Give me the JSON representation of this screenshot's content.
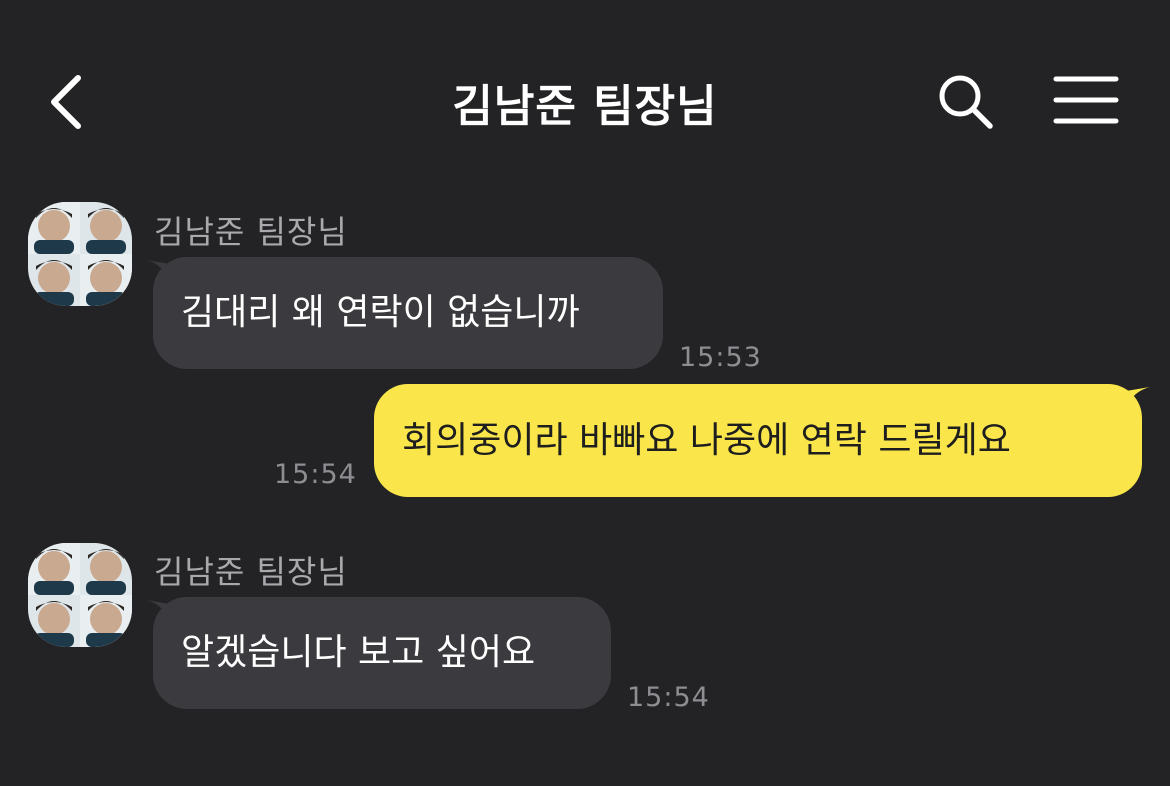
{
  "header": {
    "title": "김남준 팀장님",
    "back_icon": "chevron-left-icon",
    "search_icon": "search-icon",
    "menu_icon": "hamburger-menu-icon"
  },
  "messages": [
    {
      "direction": "incoming",
      "sender": "김남준 팀장님",
      "text": "김대리 왜 연락이 없습니까",
      "time": "15:53"
    },
    {
      "direction": "outgoing",
      "text": "회의중이라 바빠요 나중에 연락 드릴게요",
      "time": "15:54"
    },
    {
      "direction": "incoming",
      "sender": "김남준 팀장님",
      "text": "알겠습니다 보고 싶어요",
      "time": "15:54"
    }
  ],
  "colors": {
    "background": "#232325",
    "incoming_bubble": "#3b3b3f",
    "outgoing_bubble": "#fae64b",
    "timestamp": "#8e8e92",
    "sender_name": "#a9a9ad"
  }
}
